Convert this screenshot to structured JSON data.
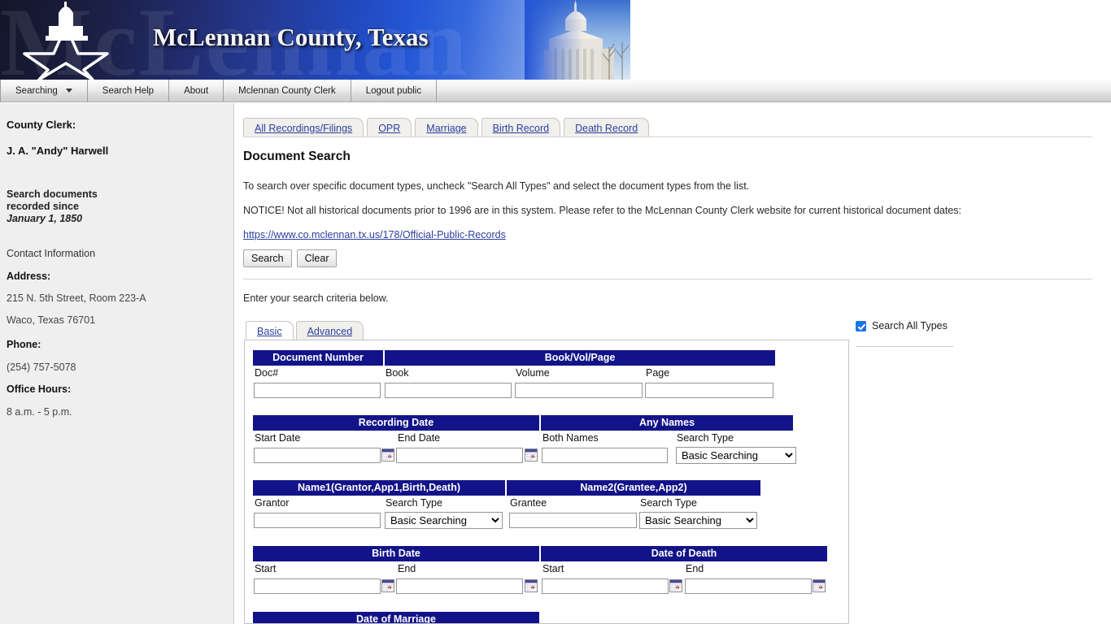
{
  "banner": {
    "title": "McLennan County, Texas",
    "watermark": "McLennan",
    "star_icon": "star-courthouse-logo",
    "photo_icon": "courthouse-photo"
  },
  "nav": {
    "items": [
      {
        "label": "Searching",
        "has_caret": true
      },
      {
        "label": "Search Help",
        "has_caret": false
      },
      {
        "label": "About",
        "has_caret": false
      },
      {
        "label": "Mclennan County Clerk",
        "has_caret": false
      },
      {
        "label": "Logout public",
        "has_caret": false
      }
    ]
  },
  "sidebar": {
    "clerk_title": "County Clerk:",
    "clerk_name": "J. A. \"Andy\" Harwell",
    "since_line1": "Search documents",
    "since_line2": "recorded since",
    "since_line3": "January 1, 1850",
    "contact_heading": "Contact Information",
    "address_label": "Address:",
    "address_line1": "215 N. 5th Street, Room 223-A",
    "address_line2": "Waco, Texas 76701",
    "phone_label": "Phone:",
    "phone_value": "(254) 757-5078",
    "hours_label": "Office Hours:",
    "hours_value": "8 a.m. - 5 p.m."
  },
  "record_tabs": [
    {
      "label": "All Recordings/Filings"
    },
    {
      "label": "OPR"
    },
    {
      "label": "Marriage"
    },
    {
      "label": "Birth Record"
    },
    {
      "label": "Death Record"
    }
  ],
  "main": {
    "page_title": "Document Search",
    "paragraph1": "To search over specific document types, uncheck \"Search All Types\" and select the document types from the list.",
    "paragraph2": "NOTICE! Not all historical documents prior to 1996 are in this system. Please refer to the McLennan County Clerk website for current historical document dates:",
    "link_text": "https://www.co.mclennan.tx.us/178/Official-Public-Records",
    "search_button": "Search",
    "clear_button": "Clear",
    "criteria_text": "Enter your search criteria below."
  },
  "mode_tabs": [
    {
      "label": "Basic",
      "active": true
    },
    {
      "label": "Advanced",
      "active": false
    }
  ],
  "search_all_types": {
    "label": "Search All Types",
    "checked": true,
    "accent_color": "#1a73e8"
  },
  "form": {
    "header_color": "#131389",
    "groups": [
      {
        "name": "document-number-bookvolpage",
        "headers": [
          "Document Number",
          "Book/Vol/Page"
        ],
        "fields": [
          {
            "label": "Doc#",
            "type": "text",
            "value": "",
            "calendar": false
          },
          {
            "label": "Book",
            "type": "text",
            "value": "",
            "calendar": false
          },
          {
            "label": "Volume",
            "type": "text",
            "value": "",
            "calendar": false
          },
          {
            "label": "Page",
            "type": "text",
            "value": "",
            "calendar": false
          }
        ]
      },
      {
        "name": "recording-date-any-names",
        "headers": [
          "Recording Date",
          "Any Names"
        ],
        "fields": [
          {
            "label": "Start Date",
            "type": "text",
            "value": "",
            "calendar": true
          },
          {
            "label": "End Date",
            "type": "text",
            "value": "",
            "calendar": true
          },
          {
            "label": "Both Names",
            "type": "text",
            "value": "",
            "calendar": false
          },
          {
            "label": "Search Type",
            "type": "select",
            "value": "Basic Searching",
            "calendar": false
          }
        ]
      },
      {
        "name": "name1-name2",
        "headers": [
          "Name1(Grantor,App1,Birth,Death)",
          "Name2(Grantee,App2)"
        ],
        "fields": [
          {
            "label": "Grantor",
            "type": "text",
            "value": "",
            "calendar": false
          },
          {
            "label": "Search Type",
            "type": "select",
            "value": "Basic Searching",
            "calendar": false
          },
          {
            "label": "Grantee",
            "type": "text",
            "value": "",
            "calendar": false
          },
          {
            "label": "Search Type",
            "type": "select",
            "value": "Basic Searching",
            "calendar": false
          }
        ]
      },
      {
        "name": "birth-date-date-of-death",
        "headers": [
          "Birth Date",
          "Date of Death"
        ],
        "fields": [
          {
            "label": "Start",
            "type": "text",
            "value": "",
            "calendar": true
          },
          {
            "label": "End",
            "type": "text",
            "value": "",
            "calendar": true
          },
          {
            "label": "Start",
            "type": "text",
            "value": "",
            "calendar": true
          },
          {
            "label": "End",
            "type": "text",
            "value": "",
            "calendar": true
          }
        ]
      },
      {
        "name": "date-of-marriage",
        "headers": [
          "Date of Marriage"
        ],
        "fields": []
      }
    ],
    "search_type_options": [
      "Basic Searching"
    ]
  }
}
